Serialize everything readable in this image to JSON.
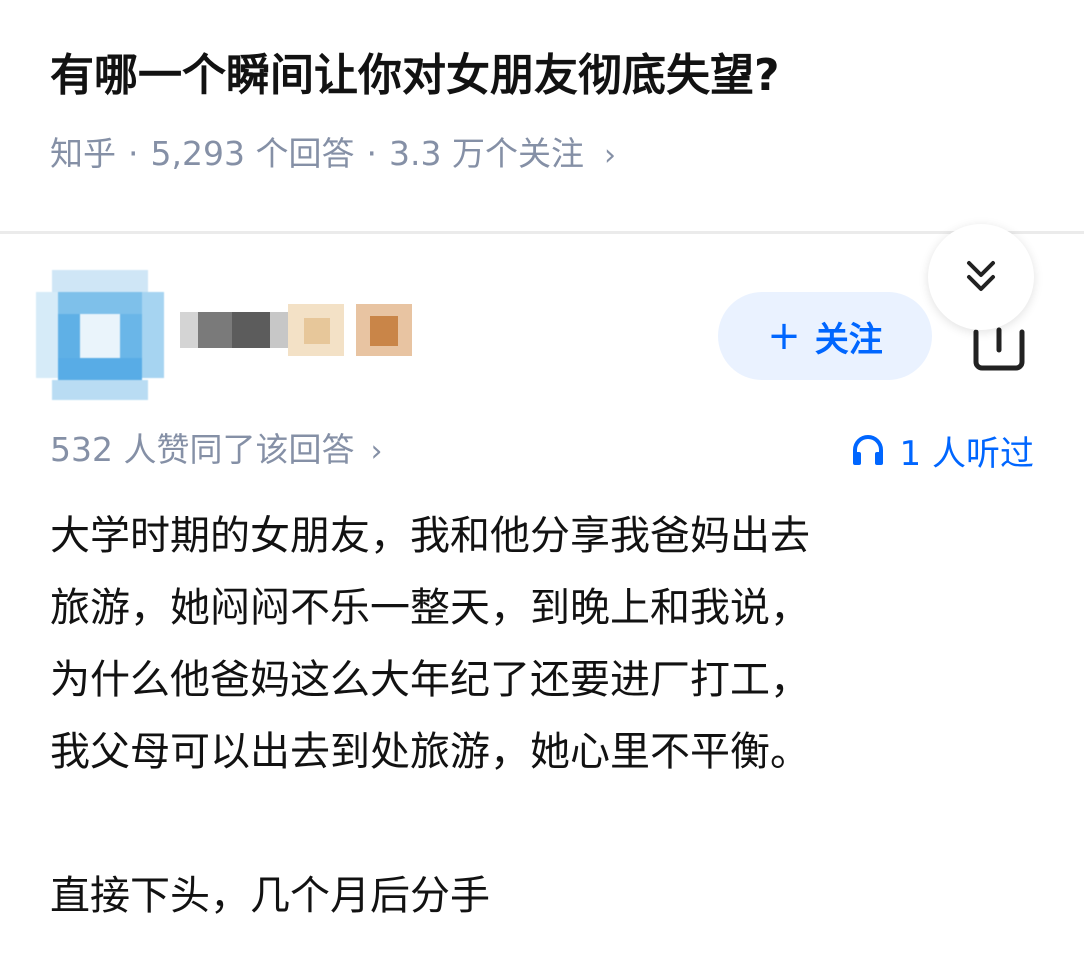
{
  "question": {
    "title": "有哪一个瞬间让你对女朋友彻底失望?",
    "source": "知乎",
    "answers": "5,293 个回答",
    "followers": "3.3 万个关注",
    "separator": "·",
    "chevron": "›"
  },
  "answer": {
    "follow_label": "关注",
    "follow_plus": "+",
    "votes": "532 人赞同了该回答",
    "votes_chevron": "›",
    "listens": "1 人听过",
    "lines": [
      "大学时期的女朋友，我和他分享我爸妈出去",
      "旅游，她闷闷不乐一整天，到晚上和我说，",
      "为什么他爸妈这么大年纪了还要进厂打工，",
      "我父母可以出去到处旅游，她心里不平衡。"
    ],
    "closing": "直接下头，几个月后分手"
  },
  "icons": {
    "collapse": "double-chevron-down-icon",
    "share": "share-icon",
    "headphones": "headphones-icon"
  },
  "colors": {
    "accent": "#0066ff",
    "follow_bg": "#eaf2ff",
    "meta_gray": "#8590a6",
    "text": "#121212"
  }
}
